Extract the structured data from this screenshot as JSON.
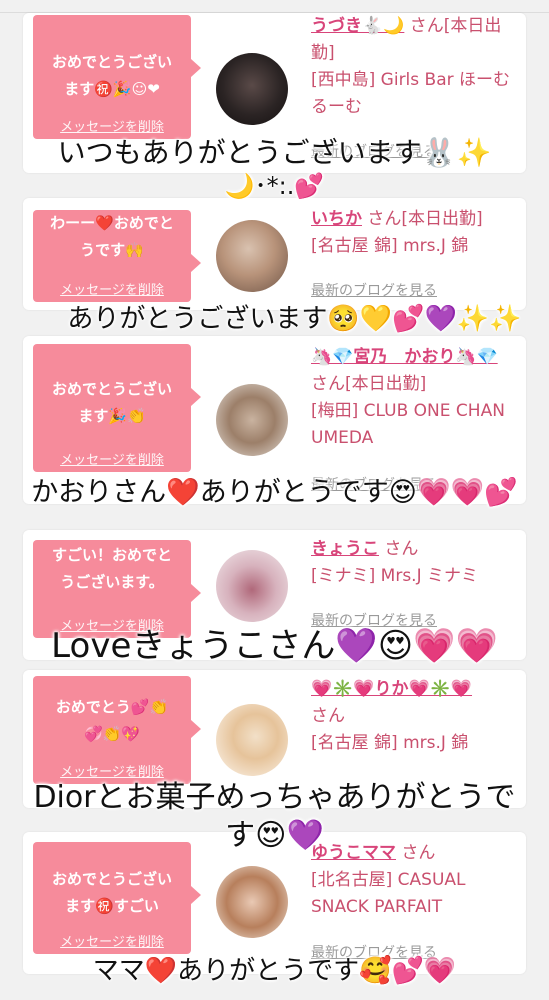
{
  "cards": [
    {
      "message": "おめでとうござい\nます㊗️🎉☺︎❤",
      "delete_label": "メッセージを削除",
      "name": "うづき🐇🌙",
      "san": "さん[本日出勤]",
      "shop": "[西中島] Girls Bar ほーむるーむ",
      "blog": "最新のブログを見る"
    },
    {
      "message": "わーー❤️おめでと\nうです🙌",
      "delete_label": "メッセージを削除",
      "name": "いちか",
      "san": "さん[本日出勤]",
      "shop": "[名古屋 錦] mrs.J 錦",
      "blog": "最新のブログを見る"
    },
    {
      "message": "おめでとうござい\nます🎉👏",
      "delete_label": "メッセージを削除",
      "name": "🦄💎宮乃　かおり🦄💎",
      "san": "さん[本日出勤]",
      "shop": "[梅田] CLUB ONE CHAN UMEDA",
      "blog": "最新のブログを見る"
    },
    {
      "message": "すごい！おめでと\nうございます。",
      "delete_label": "メッセージを削除",
      "name": "きょうこ",
      "san": "さん",
      "shop": "[ミナミ] Mrs.J ミナミ",
      "blog": "最新のブログを見る"
    },
    {
      "message": "おめでとう💕👏\n💞👏💖",
      "delete_label": "メッセージを削除",
      "name": "💗✳️💗りか💗✳️💗",
      "san": "さん",
      "shop": "[名古屋 錦] mrs.J 錦",
      "blog": "最新のブログを見る"
    },
    {
      "message": "おめでとうござい\nます㊗️すごい",
      "delete_label": "メッセージを削除",
      "name": "ゆうこママ",
      "san": "さん",
      "shop": "[北名古屋] CASUAL SNACK PARFAIT",
      "blog": "最新のブログを見る"
    }
  ],
  "captions": [
    "いつもありがとうございます🐰✨",
    "🌙･*:.💕",
    "ありがとうございます🥺💛💕💜✨✨",
    "かおりさん❤️ありがとうです😍💗💗💕",
    "Loveきょうこさん💜😍💗💗",
    "Diorとお菓子めっちゃありがとうで",
    "す😍💜",
    "ママ❤️ありがとうです🥰💕💗"
  ]
}
